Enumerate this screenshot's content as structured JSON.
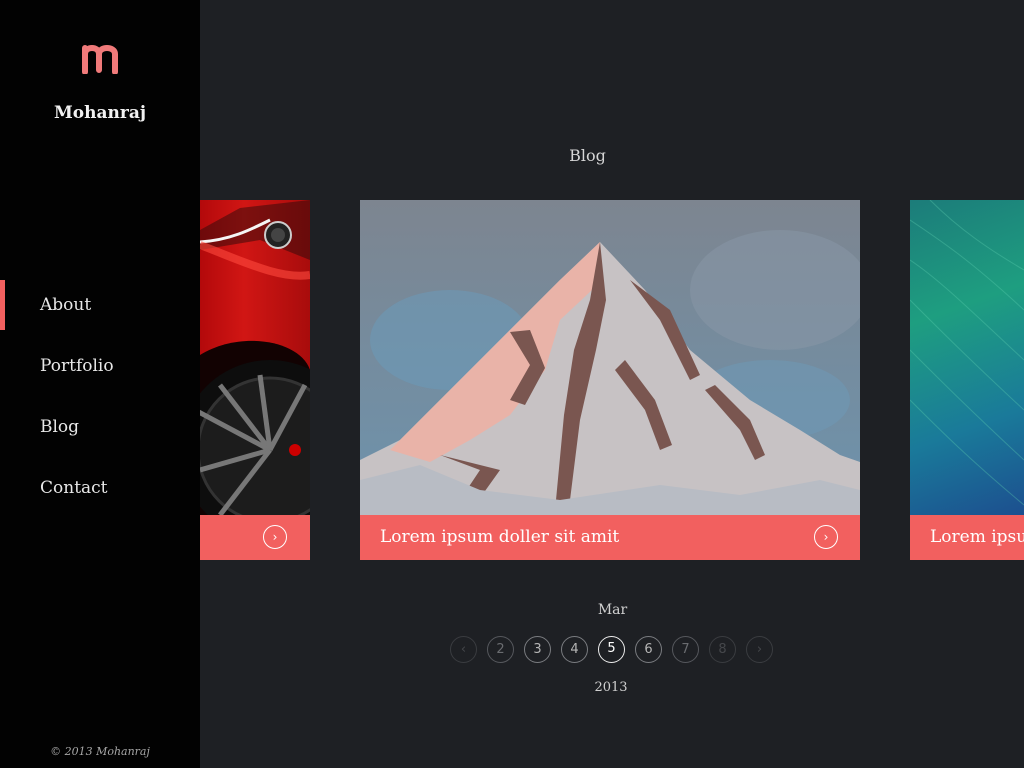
{
  "sidebar": {
    "brand": "Mohanraj",
    "logo_icon": "m-logo-icon",
    "nav": [
      {
        "label": "About",
        "active": true
      },
      {
        "label": "Portfolio",
        "active": false
      },
      {
        "label": "Blog",
        "active": false
      },
      {
        "label": "Contact",
        "active": false
      }
    ],
    "copyright": "© 2013  Mohanraj"
  },
  "main": {
    "title": "Blog",
    "cards": [
      {
        "caption": "",
        "image": "red-car-photo",
        "icon": "arrow-right-circle-icon"
      },
      {
        "caption": "Lorem ipsum doller sit amit",
        "image": "snowy-mountain-painting",
        "icon": "arrow-right-circle-icon"
      },
      {
        "caption": "Lorem ipsum doller sit amit",
        "image": "ocean-wave-photo",
        "icon": "arrow-right-circle-icon"
      }
    ]
  },
  "pager": {
    "month": "Mar",
    "year": "2013",
    "prev_icon": "chevron-left-icon",
    "next_icon": "chevron-right-icon",
    "pages": [
      "2",
      "3",
      "4",
      "5",
      "6",
      "7",
      "8"
    ],
    "current": "5"
  },
  "colors": {
    "accent": "#f2605f",
    "sidebar_bg": "#020202",
    "main_bg": "#1e2024"
  }
}
